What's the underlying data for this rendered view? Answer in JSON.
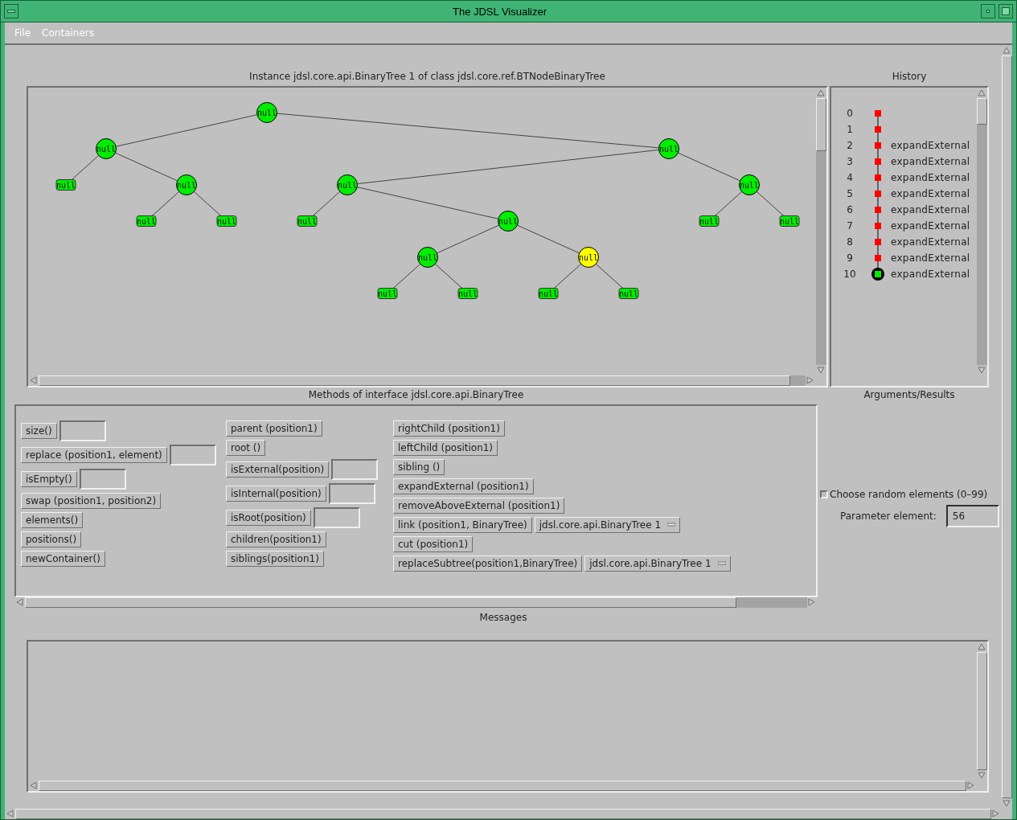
{
  "window": {
    "title": "The JDSL Visualizer"
  },
  "menu": [
    {
      "label": "File"
    },
    {
      "label": "Containers"
    }
  ],
  "tree": {
    "caption": "Instance jdsl.core.api.BinaryTree 1 of class jdsl.core.ref.BTNodeBinaryTree",
    "root": {
      "label": "null",
      "kind": "internal",
      "selected": false,
      "children": [
        {
          "label": "null",
          "kind": "internal",
          "selected": false,
          "children": [
            {
              "label": "null",
              "kind": "external",
              "selected": false
            },
            {
              "label": "null",
              "kind": "internal",
              "selected": false,
              "children": [
                {
                  "label": "null",
                  "kind": "external",
                  "selected": false
                },
                {
                  "label": "null",
                  "kind": "external",
                  "selected": false
                }
              ]
            }
          ]
        },
        {
          "label": "null",
          "kind": "internal",
          "selected": false,
          "children": [
            {
              "label": "null",
              "kind": "internal",
              "selected": false,
              "children": [
                {
                  "label": "null",
                  "kind": "external",
                  "selected": false
                },
                {
                  "label": "null",
                  "kind": "internal",
                  "selected": false,
                  "children": [
                    {
                      "label": "null",
                      "kind": "internal",
                      "selected": false,
                      "children": [
                        {
                          "label": "null",
                          "kind": "external",
                          "selected": false
                        },
                        {
                          "label": "null",
                          "kind": "external",
                          "selected": false
                        }
                      ]
                    },
                    {
                      "label": "null",
                      "kind": "internal",
                      "selected": true,
                      "children": [
                        {
                          "label": "null",
                          "kind": "external",
                          "selected": false
                        },
                        {
                          "label": "null",
                          "kind": "external",
                          "selected": false
                        }
                      ]
                    }
                  ]
                }
              ]
            },
            {
              "label": "null",
              "kind": "internal",
              "selected": false,
              "children": [
                {
                  "label": "null",
                  "kind": "external",
                  "selected": false
                },
                {
                  "label": "null",
                  "kind": "external",
                  "selected": false
                }
              ]
            }
          ]
        }
      ]
    }
  },
  "history": {
    "caption": "History",
    "items": [
      {
        "index": "0",
        "selected": false
      },
      {
        "index": "1",
        "selected": false
      },
      {
        "index": "2",
        "operation": "expandExternal",
        "selected": false
      },
      {
        "index": "3",
        "operation": "expandExternal",
        "selected": false
      },
      {
        "index": "4",
        "operation": "expandExternal",
        "selected": false
      },
      {
        "index": "5",
        "operation": "expandExternal",
        "selected": false
      },
      {
        "index": "6",
        "operation": "expandExternal",
        "selected": false
      },
      {
        "index": "7",
        "operation": "expandExternal",
        "selected": false
      },
      {
        "index": "8",
        "operation": "expandExternal",
        "selected": false
      },
      {
        "index": "9",
        "operation": "expandExternal",
        "selected": false
      },
      {
        "index": "10",
        "operation": "expandExternal",
        "selected": true
      }
    ]
  },
  "methods": {
    "caption": "Methods of interface jdsl.core.api.BinaryTree",
    "columns": [
      [
        {
          "label": "size()",
          "kind": "field"
        },
        {
          "label": "replace (position1, element)",
          "kind": "field"
        },
        {
          "label": "isEmpty()",
          "kind": "field"
        },
        {
          "label": "swap (position1, position2)",
          "kind": "plain"
        },
        {
          "label": "elements()",
          "kind": "plain"
        },
        {
          "label": "positions()",
          "kind": "plain"
        },
        {
          "label": "newContainer()",
          "kind": "plain"
        }
      ],
      [
        {
          "label": "parent (position1)",
          "kind": "plain"
        },
        {
          "label": "root ()",
          "kind": "plain"
        },
        {
          "label": "isExternal(position)",
          "kind": "field"
        },
        {
          "label": "isInternal(position)",
          "kind": "field"
        },
        {
          "label": "isRoot(position)",
          "kind": "field"
        },
        {
          "label": "children(position1)",
          "kind": "plain"
        },
        {
          "label": "siblings(position1)",
          "kind": "plain"
        }
      ],
      [
        {
          "label": "rightChild (position1)",
          "kind": "plain"
        },
        {
          "label": "leftChild (position1)",
          "kind": "plain"
        },
        {
          "label": "sibling ()",
          "kind": "plain"
        },
        {
          "label": "expandExternal (position1)",
          "kind": "plain"
        },
        {
          "label": "removeAboveExternal (position1)",
          "kind": "plain"
        },
        {
          "label": "link (position1, BinaryTree)",
          "kind": "choice",
          "choice": "jdsl.core.api.BinaryTree 1"
        },
        {
          "label": "cut (position1)",
          "kind": "plain"
        },
        {
          "label": "replaceSubtree(position1,BinaryTree)",
          "kind": "choice",
          "choice": "jdsl.core.api.BinaryTree 1"
        }
      ]
    ]
  },
  "arguments": {
    "caption": "Arguments/Results",
    "random": {
      "label": "Choose random elements (0–99)",
      "checked": false
    },
    "parameter": {
      "label": "Parameter element:",
      "value": "56"
    }
  },
  "messages": {
    "caption": "Messages"
  }
}
